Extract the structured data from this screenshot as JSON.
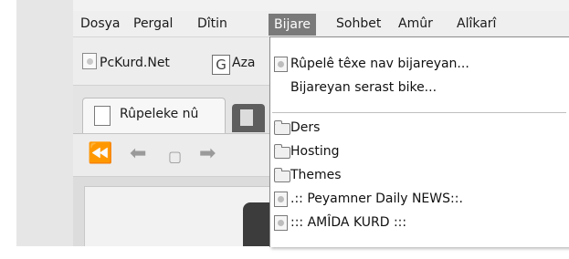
{
  "menubar": {
    "items": [
      "Dosya",
      "Pergal",
      "Dîtin",
      "Bijare",
      "Sohbet",
      "Amûr",
      "Alîkarî"
    ],
    "active_index": 3
  },
  "bookmarks_toolbar": {
    "items": [
      {
        "label": "PcKurd.Net",
        "icon": "page-icon"
      },
      {
        "label": "Aza",
        "icon": "google-icon"
      }
    ]
  },
  "tabs": {
    "items": [
      {
        "label": "Rûpeleke nû",
        "icon": "page-icon"
      }
    ]
  },
  "navbar": {
    "buttons": [
      "rewind-icon",
      "back-icon",
      "page-icon",
      "forward-icon"
    ]
  },
  "dropdown": {
    "actions": [
      {
        "label": "Rûpelê têxe nav bijareyan...",
        "icon": "bookmark-page-icon"
      },
      {
        "label": "Bijareyan serast bike...",
        "icon": ""
      }
    ],
    "folders": [
      "Ders",
      "Hosting",
      "Themes"
    ],
    "bookmarks": [
      {
        "label": ".:: Peyamner Daily NEWS::.",
        "icon": "page-icon"
      },
      {
        "label": "::: AMÎDA KURD :::",
        "icon": "page-icon"
      }
    ]
  }
}
